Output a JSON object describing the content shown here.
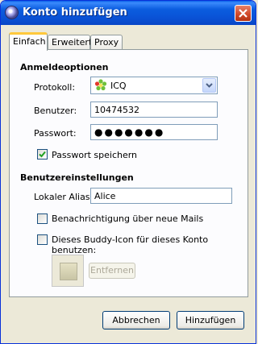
{
  "window": {
    "title": "Konto hinzufügen"
  },
  "tabs": [
    {
      "label": "Einfach",
      "active": true
    },
    {
      "label": "Erweitert",
      "active": false
    },
    {
      "label": "Proxy",
      "active": false
    }
  ],
  "login_options": {
    "heading": "Anmeldeoptionen",
    "protocol": {
      "label": "Protokoll:",
      "value": "ICQ",
      "icon": "icq-flower-icon"
    },
    "username": {
      "label": "Benutzer:",
      "value": "10474532"
    },
    "password": {
      "label": "Passwort:",
      "value": "●●●●●●●"
    },
    "remember_password": {
      "label": "Passwort speichern",
      "checked": true
    }
  },
  "user_settings": {
    "heading": "Benutzereinstellungen",
    "alias": {
      "label": "Lokaler Alias:",
      "value": "Alice"
    },
    "notify_new_mail": {
      "label": "Benachrichtigung über neue Mails",
      "checked": false
    },
    "buddy_icon": {
      "label": "Dieses Buddy-Icon für dieses Konto benutzen:",
      "checked": false
    },
    "remove_label": "Entfernen"
  },
  "buttons": {
    "cancel": "Abbrechen",
    "add": "Hinzufügen"
  },
  "colors": {
    "titlebar": "#0a52d6",
    "active_tab_accent": "#ffc83c",
    "window_bg": "#ece9d8"
  }
}
